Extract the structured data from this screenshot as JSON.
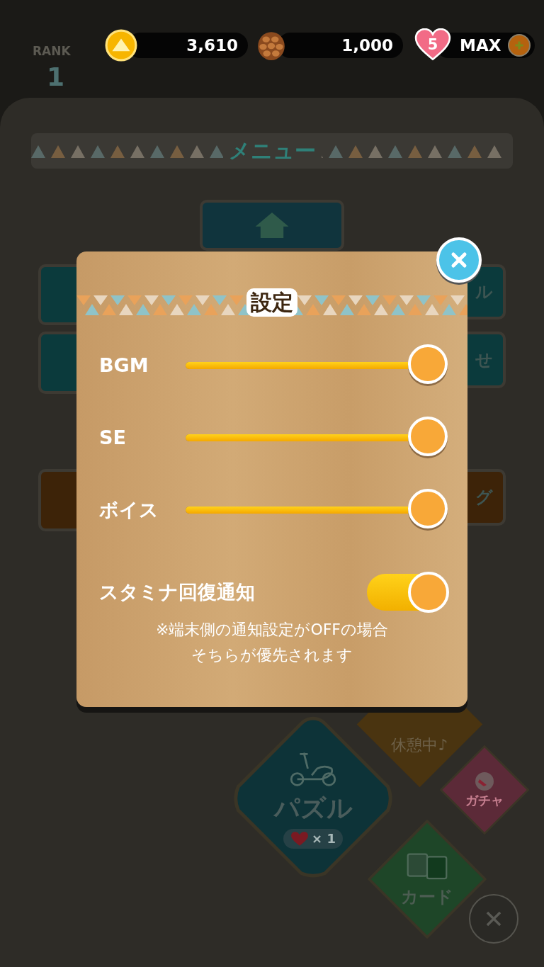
{
  "status_bar": {
    "coins": "3,610",
    "pinecones": "1,000",
    "hearts": "5",
    "stamina": "MAX"
  },
  "menu": {
    "rank_label": "RANK",
    "rank": "1",
    "title": "メニュー",
    "side_buttons": [
      {
        "label": "ル",
        "color": "#0b3a3c"
      },
      {
        "label": "せ",
        "color": "#0b3a3c"
      },
      {
        "label": "グ",
        "color": "#3d2308"
      }
    ],
    "rest_label": "休憩中♪",
    "actions": [
      {
        "kind": "puzzle",
        "label": "パズル",
        "cost": "× 1"
      },
      {
        "kind": "gacha",
        "label": "ガチャ"
      },
      {
        "kind": "card",
        "label": "カード"
      }
    ]
  },
  "dialog": {
    "title": "設定",
    "sliders": [
      {
        "label": "BGM",
        "level": 1
      },
      {
        "label": "SE",
        "level": 1
      },
      {
        "label": "ボイス",
        "level": 1
      }
    ],
    "toggles": [
      {
        "label": "スタミナ回復通知",
        "on": true
      }
    ],
    "note": [
      "※端末側の通知設定がOFFの場合",
      "そちらが優先されます"
    ]
  }
}
